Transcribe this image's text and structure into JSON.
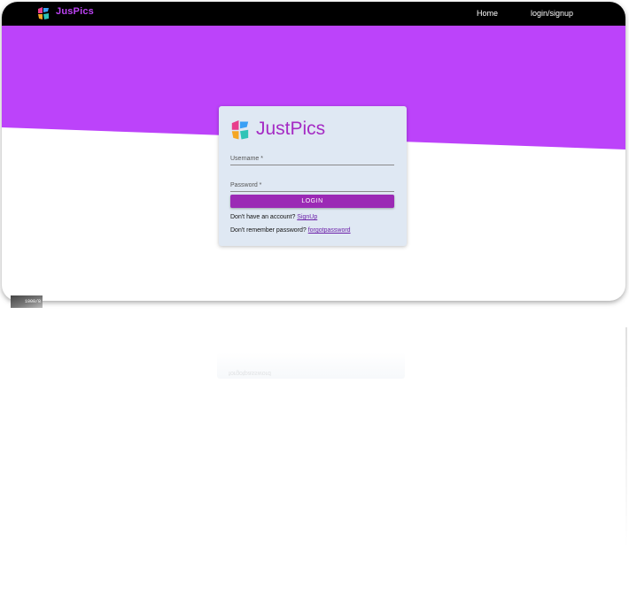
{
  "navbar": {
    "brand": "JusPics",
    "links": {
      "home": "Home",
      "login": "login/signup"
    }
  },
  "card": {
    "brand": "JustPics",
    "username_label": "Username *",
    "password_label": "Password *",
    "login_button": "LOGIN",
    "signup_prompt": "Don't have an account?",
    "signup_link": "SignUp",
    "forgot_prompt": "Don't remember password?",
    "forgot_link": "forgotpassword"
  },
  "badge": {
    "text": "1000/8"
  },
  "colors": {
    "purple_band": "#bc43fa",
    "navbar": "#000000",
    "card_bg": "#dfe8f3",
    "button": "#9b2ab5",
    "brand_text": "#a52bc4"
  }
}
